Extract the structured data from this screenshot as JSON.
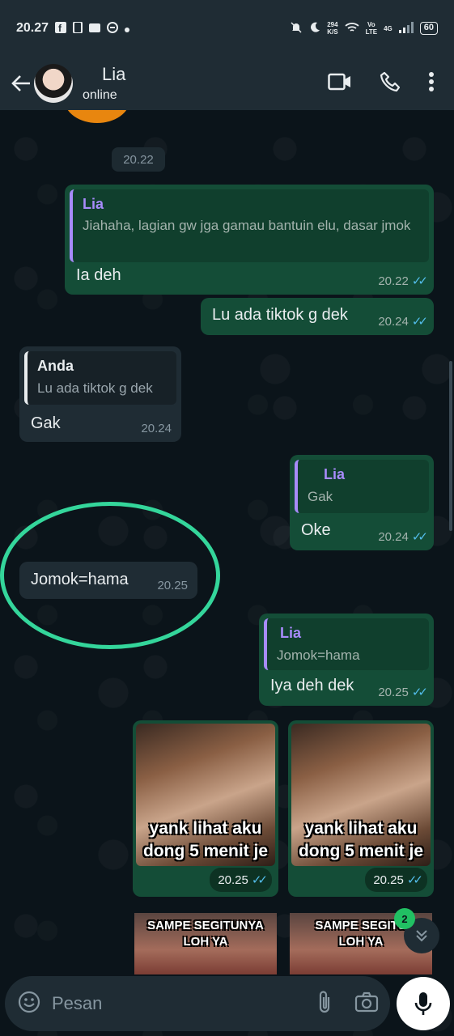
{
  "status_bar": {
    "time": "20.27",
    "net_speed_top": "294",
    "net_speed_bottom": "K/S",
    "volte_top": "Vo",
    "volte_bottom": "LTE",
    "network": "4G",
    "battery": "60"
  },
  "header": {
    "contact_name": "Lia",
    "contact_status": "online"
  },
  "chat": {
    "date_chip": "20.22",
    "messages": [
      {
        "direction": "out",
        "quote_name": "Lia",
        "quote_text": "Jiahaha, lagian gw jga gamau bantuin elu, dasar jmok",
        "text": "Ia deh",
        "time": "20.22"
      },
      {
        "direction": "out",
        "text": "Lu ada tiktok g dek",
        "time": "20.24"
      },
      {
        "direction": "in",
        "quote_name": "Anda",
        "quote_text": "Lu ada tiktok g dek",
        "text": "Gak",
        "time": "20.24"
      },
      {
        "direction": "out",
        "quote_name": "Lia",
        "quote_text": "Gak",
        "text": "Oke",
        "time": "20.24"
      },
      {
        "direction": "in",
        "text": "Jomok=hama",
        "time": "20.25"
      },
      {
        "direction": "out",
        "quote_name": "Lia",
        "quote_text": "Jomok=hama",
        "text": "Iya deh dek",
        "time": "20.25"
      }
    ],
    "media": [
      {
        "caption_line1": "yank lihat aku",
        "caption_line2": "dong 5 menit je",
        "time": "20.25"
      },
      {
        "caption_line1": "yank lihat aku",
        "caption_line2": "dong 5 menit je",
        "time": "20.25"
      }
    ],
    "media_partial": [
      {
        "caption_line1": "SAMPE SEGITUNYA",
        "caption_line2": "LOH YA"
      },
      {
        "caption_line1": "SAMPE SEGITU",
        "caption_line2": "LOH YA"
      }
    ],
    "unread_count": "2",
    "highlight_color": "#34d69b"
  },
  "composer": {
    "placeholder": "Pesan"
  },
  "colors": {
    "background": "#0b141a",
    "outgoing_bubble": "#144d37",
    "incoming_bubble": "#1f2c34",
    "read_ticks": "#53bdeb",
    "quote_accent": "#a78bfa"
  }
}
